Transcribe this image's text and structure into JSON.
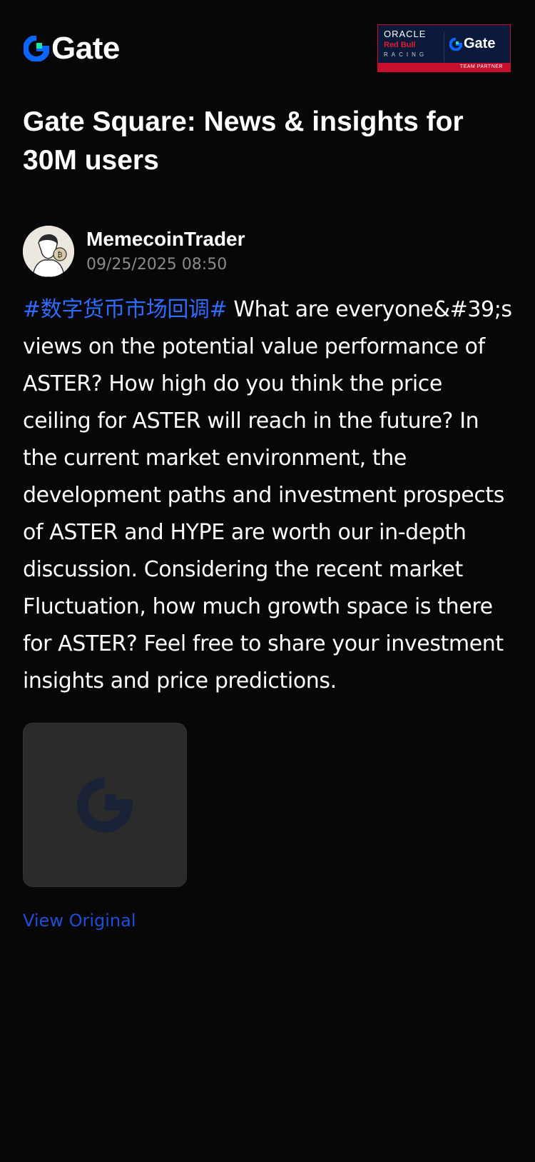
{
  "header": {
    "brand_name": "Gate",
    "partner_badge": {
      "line1": "ORACLE",
      "line2": "Red Bull",
      "line3": "RACING",
      "brand": "Gate",
      "strip_text": "TEAM PARTNER"
    }
  },
  "page_title": "Gate Square: News & insights for 30M users",
  "post": {
    "author_name": "MemecoinTrader",
    "timestamp": "09/25/2025 08:50",
    "hashtag": "#数字货币市场回调#",
    "body": " What are everyone&#39;s views on the potential value performance of ASTER? How high do you think the price ceiling for ASTER will reach in the future? In the current market environment, the development paths and investment prospects of ASTER and HYPE are worth our in-depth discussion. Considering the recent market Fluctuation, how much growth space is there for ASTER? Feel free to share your investment insights and price predictions.",
    "view_original_label": "View Original"
  },
  "icons": {
    "brand_logo": "gate-logo-icon",
    "avatar": "avatar",
    "image_placeholder": "gate-placeholder-icon"
  },
  "colors": {
    "background": "#070707",
    "hashtag": "#2f6bff",
    "link": "#1f4ed8",
    "timestamp": "#8a8a8a",
    "brand_blue": "#0055ff",
    "brand_green": "#17e5a1"
  }
}
